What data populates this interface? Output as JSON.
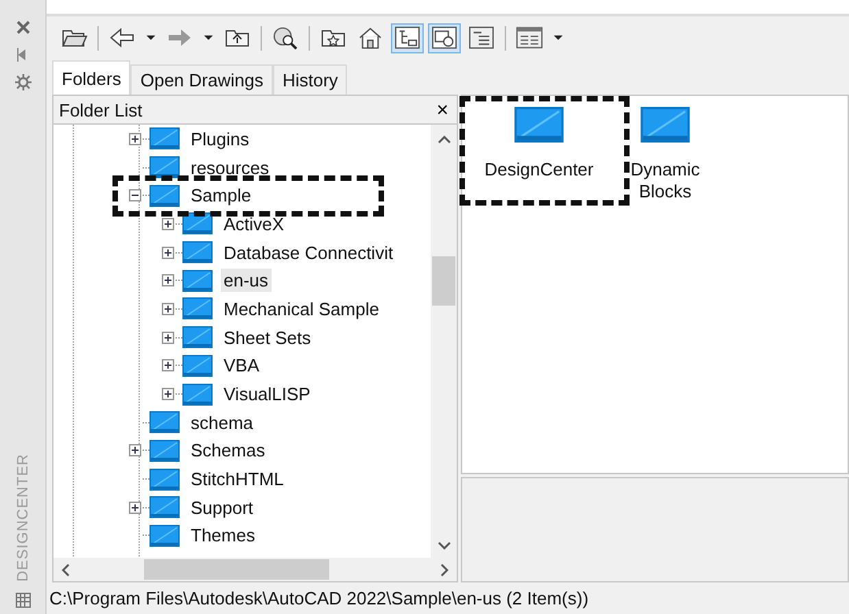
{
  "side_title": "DESIGNCENTER",
  "toolbar": [
    {
      "kind": "open",
      "pressed": false
    },
    {
      "kind": "back",
      "pressed": false
    },
    {
      "kind": "dropdown",
      "pressed": false
    },
    {
      "kind": "forward",
      "pressed": false
    },
    {
      "kind": "dropdown",
      "pressed": false
    },
    {
      "kind": "up",
      "pressed": false
    },
    {
      "kind": "search",
      "pressed": false
    },
    {
      "kind": "favorites",
      "pressed": false
    },
    {
      "kind": "home",
      "pressed": false
    },
    {
      "kind": "tree",
      "pressed": true
    },
    {
      "kind": "preview",
      "pressed": true
    },
    {
      "kind": "description",
      "pressed": false
    },
    {
      "kind": "views",
      "pressed": false
    },
    {
      "kind": "dropdown",
      "pressed": false
    }
  ],
  "tabs": [
    {
      "label": "Folders",
      "selected": true
    },
    {
      "label": "Open Drawings",
      "selected": false
    },
    {
      "label": "History",
      "selected": false
    }
  ],
  "folder_list": {
    "title": "Folder List",
    "close": "×"
  },
  "tree": [
    {
      "label": "Plugins",
      "kind": "expandable",
      "expanded": false,
      "selected": false
    },
    {
      "label": "resources",
      "kind": "leaf",
      "selected": false
    },
    {
      "label": "Sample",
      "kind": "expandable",
      "expanded": true,
      "selected": false,
      "children": [
        {
          "label": "ActiveX",
          "kind": "expandable",
          "expanded": false,
          "selected": false
        },
        {
          "label": "Database Connectivit",
          "kind": "expandable",
          "expanded": false,
          "selected": false
        },
        {
          "label": "en-us",
          "kind": "expandable",
          "expanded": false,
          "selected": true
        },
        {
          "label": "Mechanical Sample",
          "kind": "expandable",
          "expanded": false,
          "selected": false
        },
        {
          "label": "Sheet Sets",
          "kind": "expandable",
          "expanded": false,
          "selected": false
        },
        {
          "label": "VBA",
          "kind": "expandable",
          "expanded": false,
          "selected": false
        },
        {
          "label": "VisualLISP",
          "kind": "expandable",
          "expanded": false,
          "selected": false
        }
      ]
    },
    {
      "label": "schema",
      "kind": "leaf",
      "selected": false
    },
    {
      "label": "Schemas",
      "kind": "expandable",
      "expanded": false,
      "selected": false
    },
    {
      "label": "StitchHTML",
      "kind": "leaf",
      "selected": false
    },
    {
      "label": "Support",
      "kind": "expandable",
      "expanded": false,
      "selected": false
    },
    {
      "label": "Themes",
      "kind": "leaf",
      "selected": false
    }
  ],
  "content_items": [
    {
      "label": "DesignCenter"
    },
    {
      "label": "Dynamic Blocks"
    }
  ],
  "status_bar": "C:\\Program Files\\Autodesk\\AutoCAD 2022\\Sample\\en-us (2 Item(s))"
}
